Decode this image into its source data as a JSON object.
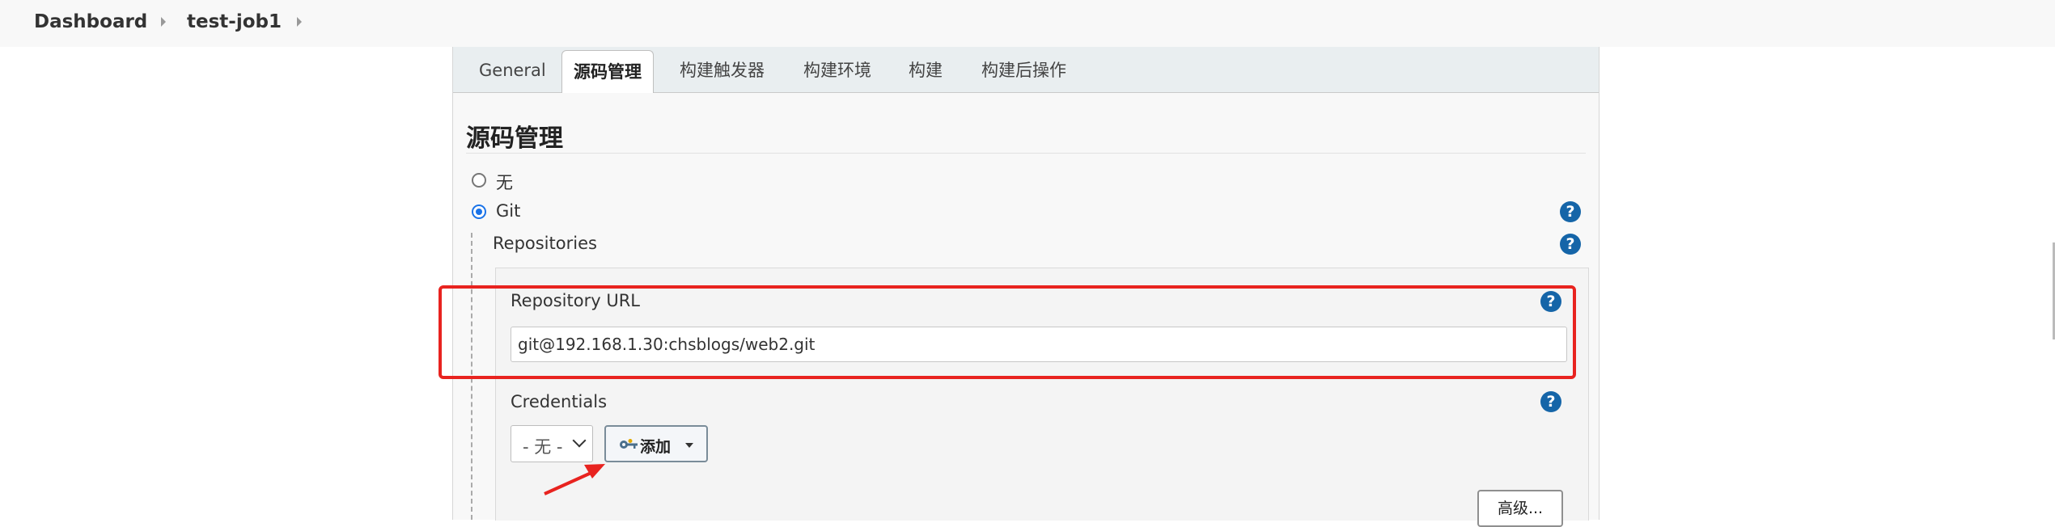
{
  "breadcrumb": {
    "items": [
      "Dashboard",
      "test-job1"
    ]
  },
  "tabs": [
    {
      "label": "General",
      "active": false
    },
    {
      "label": "源码管理",
      "active": true
    },
    {
      "label": "构建触发器",
      "active": false
    },
    {
      "label": "构建环境",
      "active": false
    },
    {
      "label": "构建",
      "active": false
    },
    {
      "label": "构建后操作",
      "active": false
    }
  ],
  "scm": {
    "section_title": "源码管理",
    "options": [
      {
        "label": "无",
        "selected": false
      },
      {
        "label": "Git",
        "selected": true
      }
    ],
    "repositories_label": "Repositories",
    "repository_url_label": "Repository URL",
    "repository_url_value": "git@192.168.1.30:chsblogs/web2.git",
    "credentials_label": "Credentials",
    "credentials_selected": "- 无 -",
    "add_button_label": "添加",
    "advanced_button_label": "高级...",
    "help_icon_glyph": "?"
  },
  "icons": {
    "help": "help-icon",
    "key": "key-icon",
    "caret": "caret-down-icon",
    "chevron": "chevron-down-icon"
  },
  "colors": {
    "accent": "#1565a8",
    "radio_selected": "#1a73e8",
    "annotation_red": "#e8231f"
  }
}
